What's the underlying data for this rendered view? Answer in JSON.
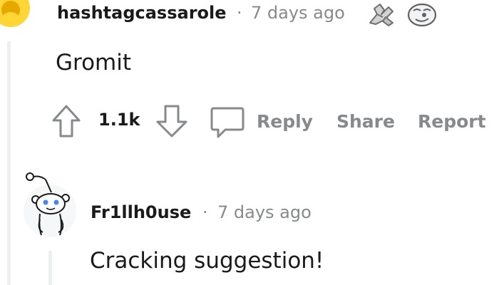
{
  "comments": [
    {
      "username": "hashtagcassarole",
      "separator": "·",
      "timestamp": "7 days ago",
      "awards": [
        "arm-wrestling-award-icon",
        "smiling-face-award-icon"
      ],
      "body": "Gromit",
      "score": "1.1k",
      "actions": {
        "reply": "Reply",
        "share": "Share",
        "report": "Report"
      }
    },
    {
      "username": "Fr1llh0use",
      "separator": "·",
      "timestamp": "7 days ago",
      "avatar": "snoo-avatar-icon",
      "body": "Cracking suggestion!"
    }
  ],
  "colors": {
    "text": "#1a1a1b",
    "meta": "#878a8c",
    "thread_line": "#edeff1",
    "avatar_yellow": "#ffd635"
  }
}
